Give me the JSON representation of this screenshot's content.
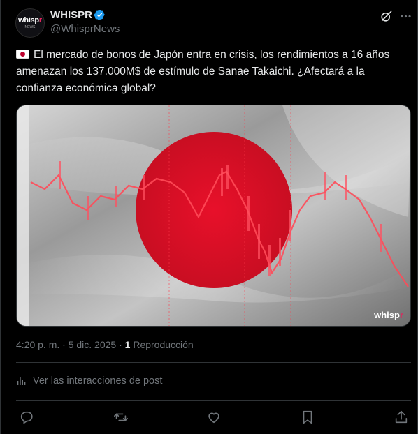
{
  "post": {
    "author_name": "WHISPR",
    "author_handle": "@WhisprNews",
    "avatar_text": "whispr",
    "avatar_subtext": "NEWS",
    "text": "El mercado de bonos de Japón entra en crisis, los rendimientos a 16 años amenazan los 137.000M$ de estímulo de Sanae Takaichi. ¿Afectará a la confianza económica global?",
    "media_watermark": "whispr",
    "timestamp": "4:20 p. m. · 5 dic. 2025 · ",
    "views_count": "1",
    "views_label": " Reproducción",
    "analytics_label": "Ver las interacciones de post"
  },
  "colors": {
    "background": "#000000",
    "text": "#e7e9ea",
    "muted": "#71767b",
    "verified": "#1d9bf0",
    "flag_red": "#bc002d"
  },
  "icons": [
    "verified-badge-icon",
    "grok-icon",
    "more-icon",
    "flag-japan-icon",
    "analytics-icon",
    "reply-icon",
    "repost-icon",
    "like-icon",
    "bookmark-icon",
    "share-icon"
  ]
}
